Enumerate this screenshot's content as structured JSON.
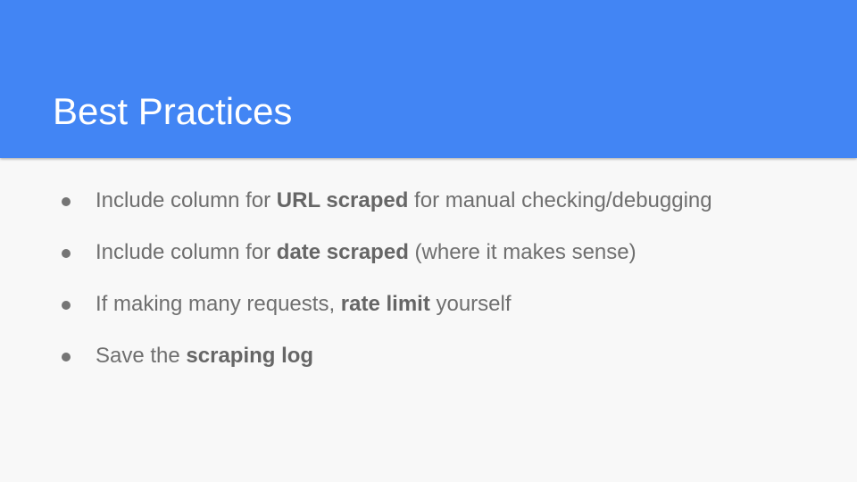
{
  "slide": {
    "title": "Best Practices",
    "colors": {
      "header_bg": "#4285f4",
      "body_bg": "#f8f8f8",
      "title_text": "#ffffff",
      "body_text": "#6f6f6f"
    },
    "bullets": [
      {
        "before": "Include column for ",
        "bold": "URL scraped",
        "after": " for manual checking/debugging"
      },
      {
        "before": "Include column for ",
        "bold": "date scraped",
        "after": " (where it makes sense)"
      },
      {
        "before": "If making many requests, ",
        "bold": "rate limit",
        "after": " yourself"
      },
      {
        "before": "Save the ",
        "bold": "scraping log",
        "after": ""
      }
    ]
  }
}
